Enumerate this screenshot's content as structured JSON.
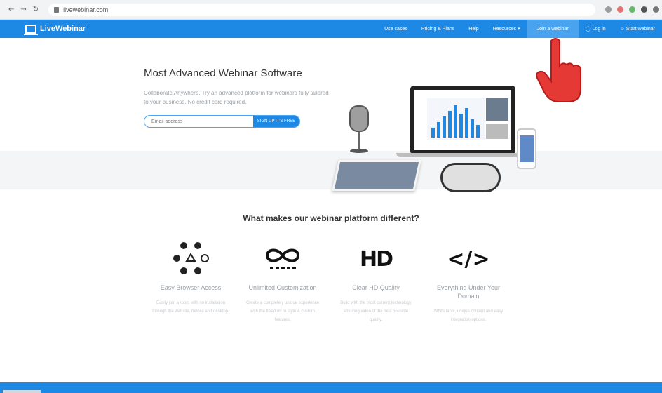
{
  "browser": {
    "url": "livewebinar.com",
    "nav_icons": [
      "back-icon",
      "forward-icon",
      "reload-icon"
    ]
  },
  "header": {
    "brand": "LiveWebinar",
    "menu": [
      "Use cases",
      "Pricing & Plans",
      "Help",
      "Resources",
      "Join a webinar",
      "Log in",
      "Start webinar"
    ],
    "accent": "#1e88e5"
  },
  "hero": {
    "title": "Most Advanced Webinar Software",
    "description": "Collaborate Anywhere. Try an advanced platform for webinars fully tailored to your business. No credit card required.",
    "email_placeholder": "Email address",
    "signup_label": "SIGN UP IT'S FREE"
  },
  "features": {
    "heading": "What makes our webinar platform different?",
    "items": [
      {
        "title": "Easy Browser Access",
        "desc": "Easily join a room with no installation through the website, mobile and desktop.",
        "icon": "devices-icon"
      },
      {
        "title": "Unlimited Customization",
        "desc": "Create a completely unique experience with the freedom to style & custom features.",
        "icon": "infinity-icon"
      },
      {
        "title": "Clear HD Quality",
        "desc": "Build with the most current technology ensuring video of the best possible quality.",
        "icon": "hd-icon"
      },
      {
        "title": "Everything Under Your Domain",
        "desc": "White label, unique content and easy integration options.",
        "icon": "code-icon"
      }
    ]
  }
}
